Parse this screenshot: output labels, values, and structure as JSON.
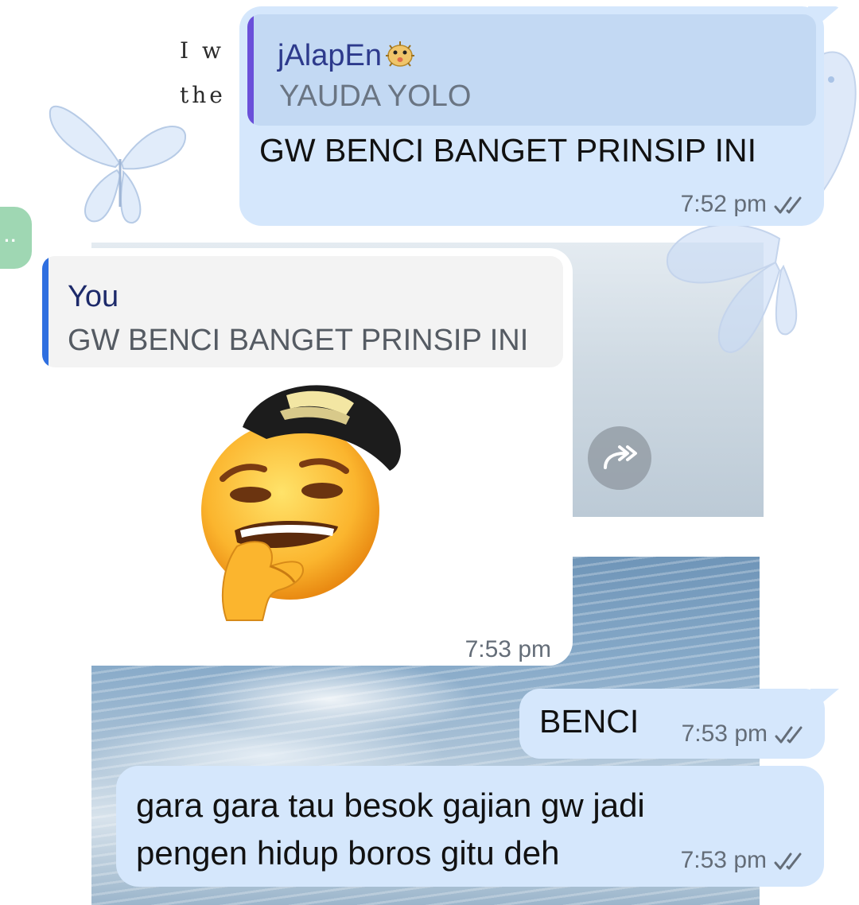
{
  "messages": [
    {
      "direction": "outgoing",
      "reply_to": {
        "sender": "jAlapEn",
        "sender_emoji": "pufferfish-emoji",
        "text": "YAUDA YOLO"
      },
      "text": "GW BENCI BANGET PRINSIP INI",
      "time": "7:52 pm",
      "status": "read-double-check"
    },
    {
      "direction": "incoming",
      "reply_to": {
        "sender": "You",
        "text": "GW BENCI BANGET PRINSIP INI"
      },
      "sticker": "thinking-face-with-backwards-cap-sticker",
      "time": "7:53 pm"
    },
    {
      "direction": "outgoing",
      "text": "BENCI",
      "time": "7:53 pm",
      "status": "read-double-check"
    },
    {
      "direction": "outgoing",
      "text": "gara gara tau besok gajian gw jadi pengen hidup boros gitu deh",
      "time": "7:53 pm",
      "status": "read-double-check"
    }
  ],
  "wallpaper": {
    "poem_line_1": "I w",
    "poem_line_2": "the"
  },
  "side_handle": {
    "label": "··"
  },
  "forward_button": {
    "icon": "forward-arrow-icon"
  },
  "colors": {
    "outgoing_bubble": "#d5e7fc",
    "incoming_bubble": "#ffffff",
    "quote_bar_outgoing": "#6a4fd9",
    "quote_bar_incoming": "#2f6fe0",
    "timestamp": "#646d78"
  }
}
